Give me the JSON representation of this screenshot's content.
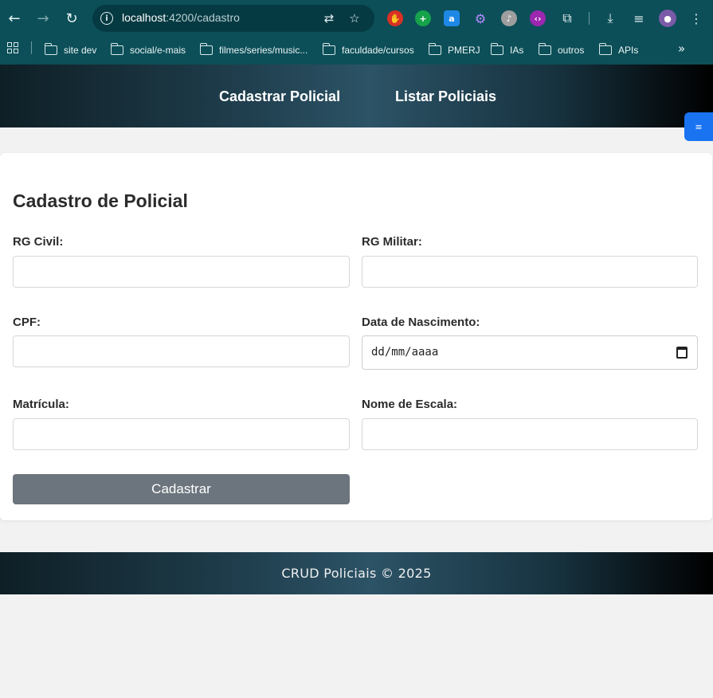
{
  "browser": {
    "url_host": "localhost",
    "url_path": ":4200/cadastro",
    "bookmarks": [
      {
        "label": "site dev"
      },
      {
        "label": "social/e-mais"
      },
      {
        "label": "filmes/series/music..."
      },
      {
        "label": "faculdade/cursos"
      },
      {
        "label": "PMERJ"
      },
      {
        "label": "IAs"
      },
      {
        "label": "outros"
      },
      {
        "label": "APIs"
      }
    ],
    "icons": [
      "back-icon",
      "forward-icon",
      "reload-icon",
      "site-info-icon",
      "translate-icon",
      "bookmark-star-icon",
      "download-icon",
      "media-control-icon",
      "profile-avatar",
      "menu-icon"
    ]
  },
  "nav": {
    "cadastrar": "Cadastrar Policial",
    "listar": "Listar Policiais"
  },
  "form": {
    "title": "Cadastro de Policial",
    "rg_civil": {
      "label": "RG Civil:",
      "value": ""
    },
    "rg_militar": {
      "label": "RG Militar:",
      "value": ""
    },
    "cpf": {
      "label": "CPF:",
      "value": ""
    },
    "data_nascimento": {
      "label": "Data de Nascimento:",
      "placeholder": "dd/mm/aaaa"
    },
    "matricula": {
      "label": "Matrícula:",
      "value": ""
    },
    "nome_escala": {
      "label": "Nome de Escala:",
      "value": ""
    },
    "submit_label": "Cadastrar"
  },
  "floating_button": {
    "glyph": "≡"
  },
  "footer": {
    "text": "CRUD Policiais © 2025"
  },
  "colors": {
    "browser_chrome": "#0c4f58",
    "button_gray": "#6c757d",
    "floating_blue": "#1a73f0"
  }
}
